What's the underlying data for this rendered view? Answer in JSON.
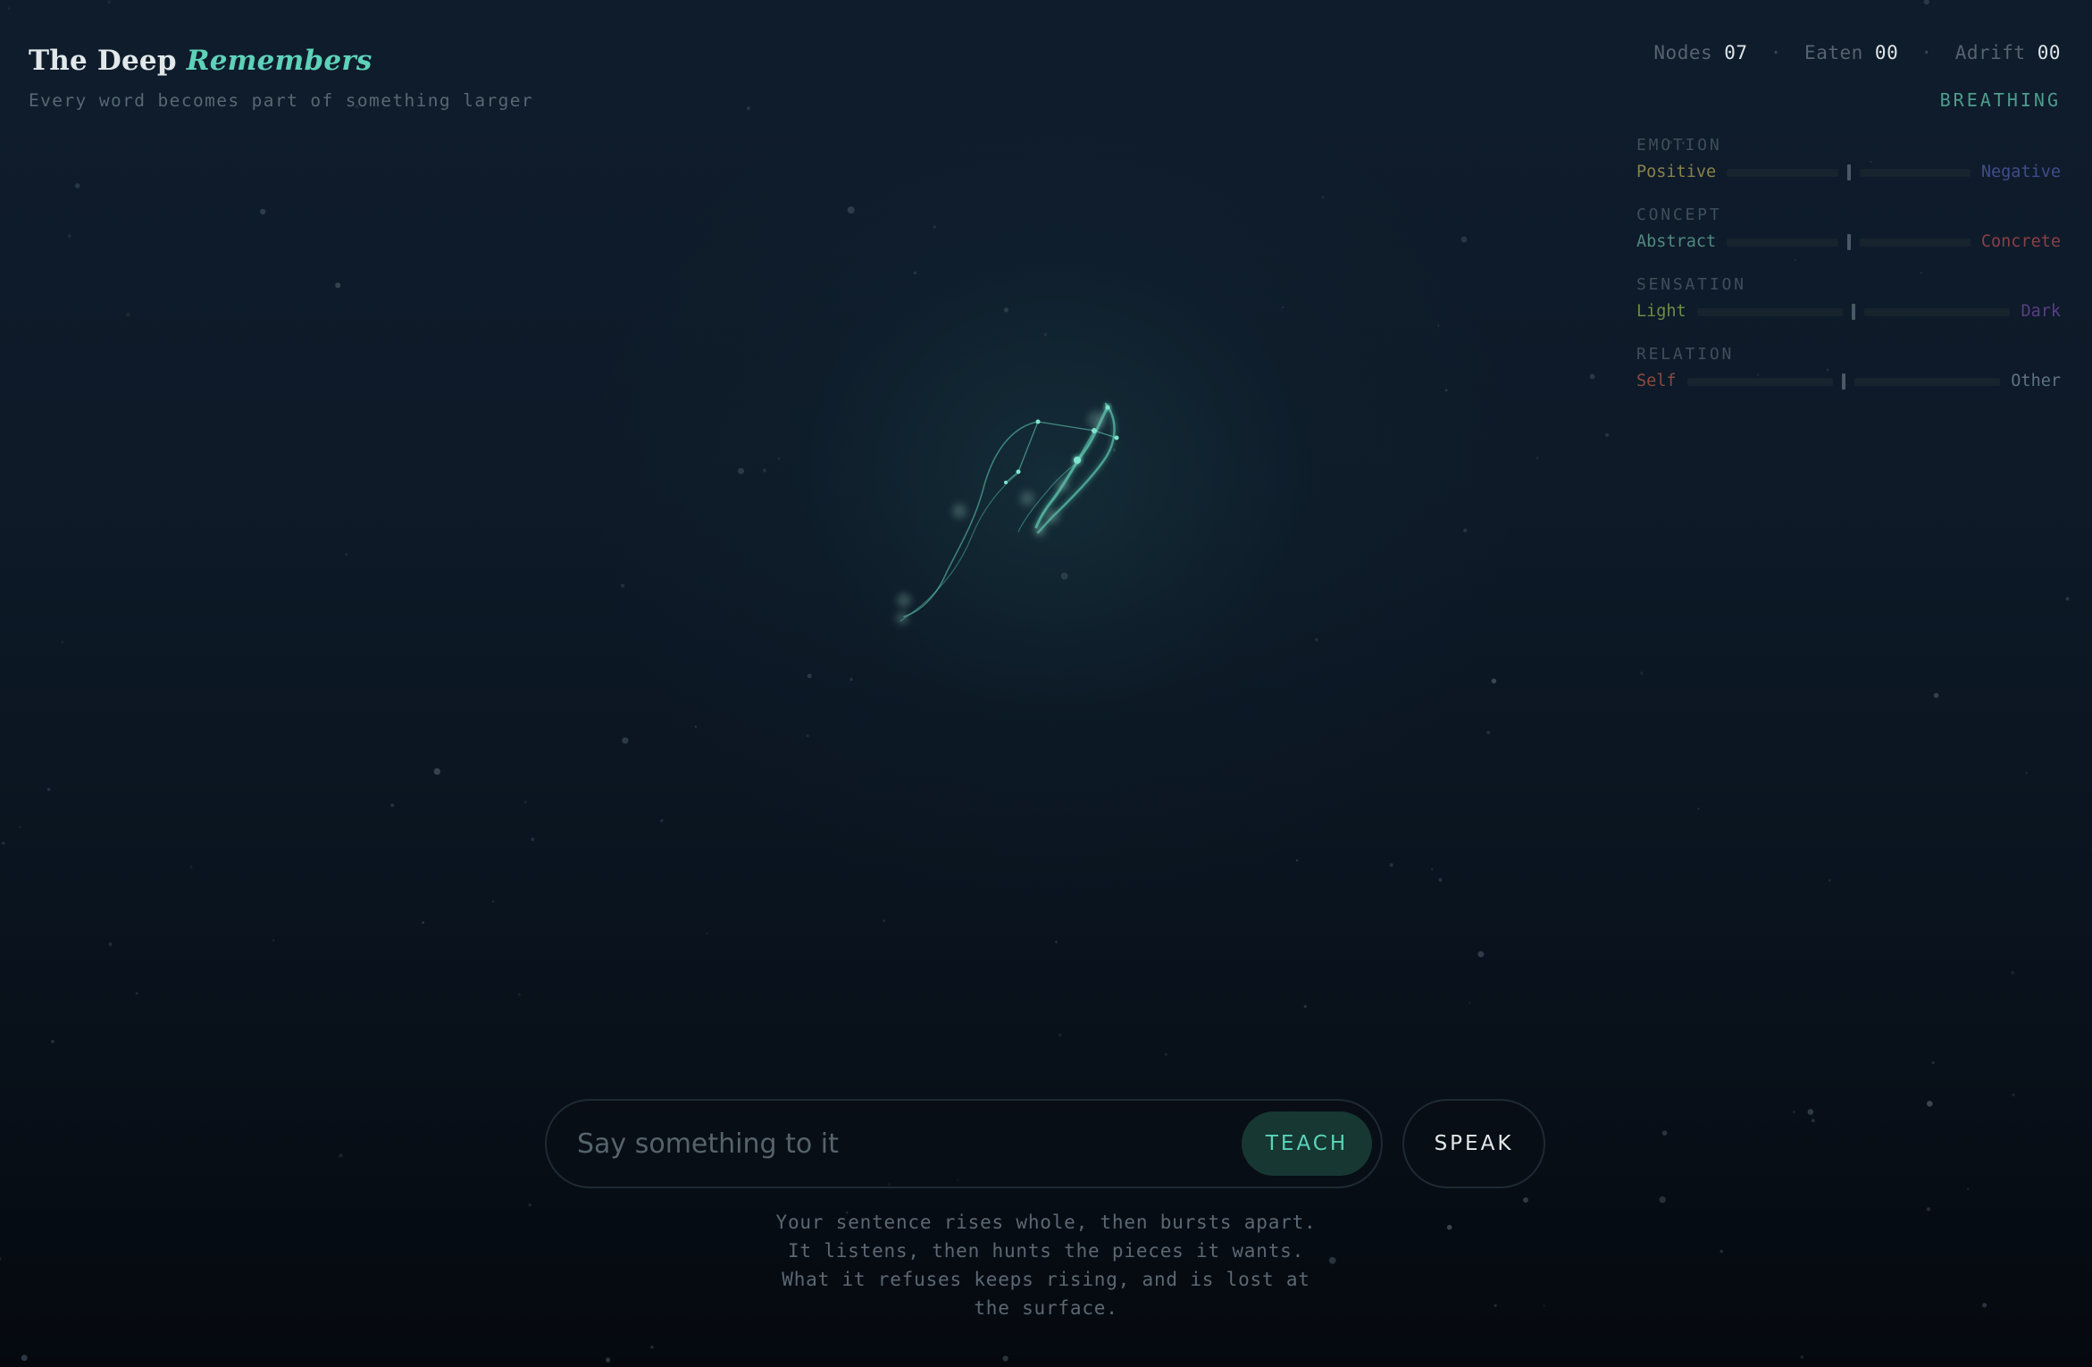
{
  "header": {
    "title": "The Deep",
    "title_accent": "Remembers",
    "subtitle": "Every word becomes part of something larger"
  },
  "stats": {
    "nodes_label": "Nodes",
    "nodes_value": "07",
    "eaten_label": "Eaten",
    "eaten_value": "00",
    "adrift_label": "Adrift",
    "adrift_value": "00",
    "separator": "·",
    "state": "BREATHING"
  },
  "axes": [
    {
      "name": "EMOTION",
      "left": "Positive",
      "right": "Negative",
      "left_color": "#8a8248",
      "right_color": "#414c8c",
      "value": 0.0
    },
    {
      "name": "CONCEPT",
      "left": "Abstract",
      "right": "Concrete",
      "left_color": "#4f8a7e",
      "right_color": "#8a3f46",
      "value": 0.0
    },
    {
      "name": "SENSATION",
      "left": "Light",
      "right": "Dark",
      "left_color": "#6d8d45",
      "right_color": "#5a3d86",
      "value": 0.0
    },
    {
      "name": "RELATION",
      "left": "Self",
      "right": "Other",
      "left_color": "#8a4b3c",
      "right_color": "#5d7282",
      "value": 0.0
    }
  ],
  "input": {
    "placeholder": "Say something to it",
    "value": "",
    "teach_label": "TEACH",
    "speak_label": "SPEAK"
  },
  "hint": [
    "Your sentence rises whole, then bursts apart.",
    "It listens, then hunts the pieces it wants.",
    "What it refuses keeps rising, and is lost at",
    "the surface."
  ],
  "colors": {
    "accent": "#5ed2b9",
    "background": "#0e1a28",
    "creature": "#6fe0c6"
  }
}
